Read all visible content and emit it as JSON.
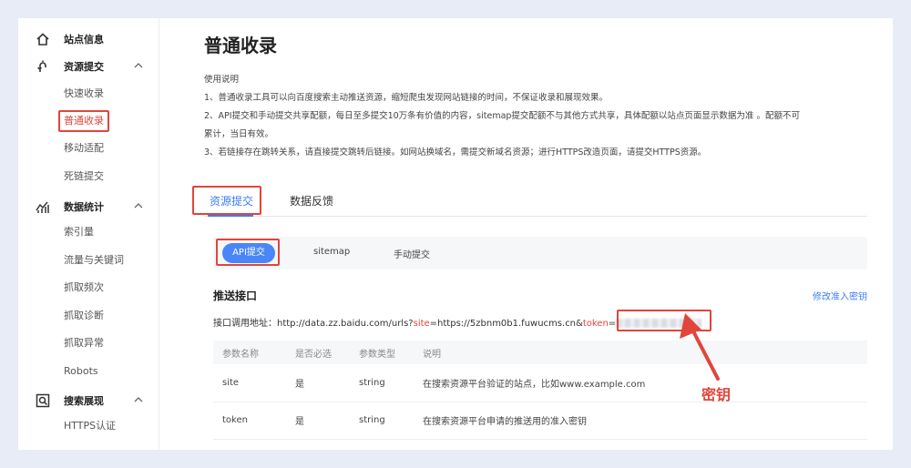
{
  "sidebar": {
    "groups": [
      {
        "label": "站点信息",
        "icon": "home-icon",
        "items": []
      },
      {
        "label": "资源提交",
        "icon": "resource-submit-icon",
        "items": [
          "快速收录",
          "普通收录",
          "移动适配",
          "死链提交"
        ]
      },
      {
        "label": "数据统计",
        "icon": "chart-icon",
        "items": [
          "索引量",
          "流量与关键词",
          "抓取频次",
          "抓取诊断",
          "抓取异常",
          "Robots"
        ]
      },
      {
        "label": "搜索展现",
        "icon": "search-display-icon",
        "items": [
          "HTTPS认证"
        ]
      }
    ],
    "active_item": "普通收录"
  },
  "page": {
    "title": "普通收录",
    "usage_heading": "使用说明",
    "usage_lines": [
      "1、普通收录工具可以向百度搜索主动推送资源，缩短爬虫发现网站链接的时间，不保证收录和展现效果。",
      "2、API提交和手动提交共享配额，每日至多提交10万条有价值的内容，sitemap提交配额不与其他方式共享，具体配额以站点页面显示数据为准 。配额不可",
      "累计，当日有效。",
      "3、若链接存在跳转关系，请直接提交跳转后链接。如网站换域名，需提交新域名资源；进行HTTPS改造页面，请提交HTTPS资源。"
    ]
  },
  "tabs": [
    "资源提交",
    "数据反馈"
  ],
  "subtabs": [
    "API提交",
    "sitemap",
    "手动提交"
  ],
  "push": {
    "title": "推送接口",
    "edit_link": "修改准入密钥",
    "endpoint_label": "接口调用地址：",
    "url_prefix": "http://data.zz.baidu.com/urls?",
    "site_key": "site",
    "site_value": "=https://5zbnm0b1.fuwucms.cn&",
    "token_key": "token",
    "token_eq": "="
  },
  "table": {
    "headers": [
      "参数名称",
      "是否必选",
      "参数类型",
      "说明"
    ],
    "rows": [
      [
        "site",
        "是",
        "string",
        "在搜索资源平台验证的站点，比如www.example.com"
      ],
      [
        "token",
        "是",
        "string",
        "在搜索资源平台申请的推送用的准入密钥"
      ]
    ]
  },
  "annotation": {
    "label": "密钥",
    "color": "#e0453c"
  },
  "colors": {
    "accent": "#3b7ef0",
    "highlight": "#e0453c",
    "background": "#e8ecf6"
  }
}
